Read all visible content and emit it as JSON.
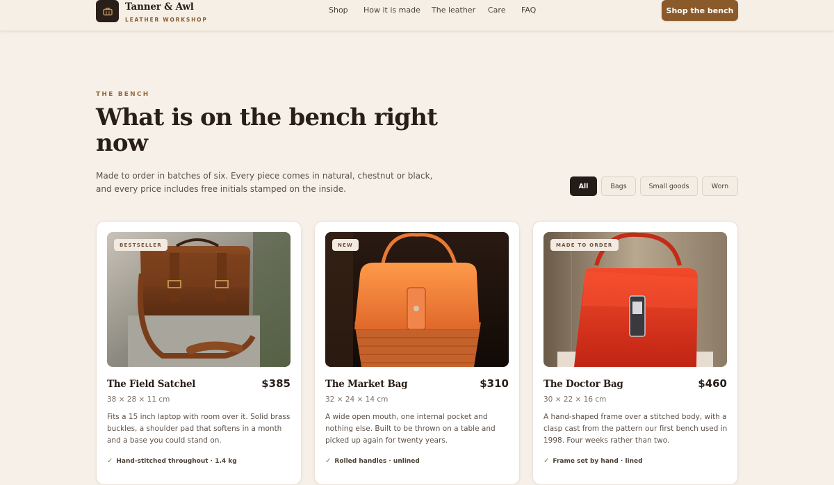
{
  "header": {
    "brand_name": "Tanner & Awl",
    "brand_tagline": "LEATHER WORKSHOP",
    "logo_icon": "briefcase-icon",
    "nav": [
      "Shop",
      "How it is made",
      "The leather",
      "Care",
      "FAQ"
    ],
    "cta": "Shop the bench"
  },
  "hero": {
    "eyebrow": "THE BENCH",
    "title": "What is on the bench right now",
    "lede": "Made to order in batches of six. Every piece comes in natural, chestnut or black, and every price includes free initials stamped on the inside."
  },
  "filters": {
    "options": [
      "All",
      "Bags",
      "Small goods",
      "Worn"
    ],
    "selected": "All"
  },
  "products": [
    {
      "badge": "BESTSELLER",
      "name": "The Field Satchel",
      "price": "$385",
      "dims": "38 × 28 × 11 cm",
      "description": "Fits a 15 inch laptop with room over it. Solid brass buckles, a shoulder pad that softens in a month and a base you could stand on.",
      "feature": "Hand-stitched throughout · 1.4 kg"
    },
    {
      "badge": "NEW",
      "name": "The Market Bag",
      "price": "$310",
      "dims": "32 × 24 × 14 cm",
      "description": "A wide open mouth, one internal pocket and nothing else. Built to be thrown on a table and picked up again for twenty years.",
      "feature": "Rolled handles · unlined"
    },
    {
      "badge": "MADE TO ORDER",
      "name": "The Doctor Bag",
      "price": "$460",
      "dims": "30 × 22 × 16 cm",
      "description": "A hand-shaped frame over a stitched body, with a clasp cast from the pattern our first bench used in 1998. Four weeks rather than two.",
      "feature": "Frame set by hand · lined"
    }
  ],
  "colors": {
    "accent": "#8a5a2b",
    "background": "#f6f0e8",
    "ink": "#2a1f18"
  }
}
